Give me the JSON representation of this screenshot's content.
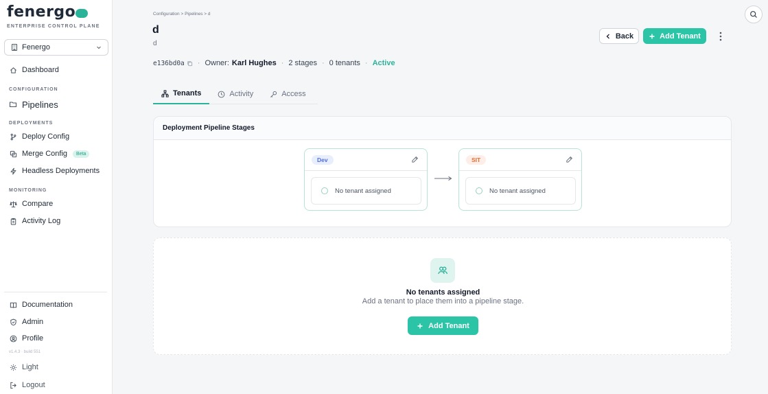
{
  "brand": {
    "logo_text": "fenergo",
    "subtitle": "ENTERPRISE CONTROL PLANE",
    "accent": "#2bc4a6"
  },
  "sidebar": {
    "org_select": "Fenergo",
    "dashboard": "Dashboard",
    "section_configuration": "CONFIGURATION",
    "pipelines": "Pipelines",
    "section_deployments": "DEPLOYMENTS",
    "deploy_config": "Deploy Config",
    "merge_config": "Merge Config",
    "beta_badge": "Beta",
    "headless": "Headless Deployments",
    "section_monitoring": "MONITORING",
    "compare": "Compare",
    "activity_log": "Activity Log",
    "documentation": "Documentation",
    "admin": "Admin",
    "profile": "Profile",
    "version": "v1.4.3 · build 551",
    "theme": "Light",
    "logout": "Logout"
  },
  "header": {
    "breadcrumb": "Configuration  >  Pipelines  >  d",
    "title": "d",
    "subtitle": "d",
    "pipeline_id": "e136bd0a",
    "owner_label": "Owner:",
    "owner_name": "Karl Hughes",
    "stages": "2 stages",
    "tenants": "0 tenants",
    "status": "Active",
    "back_label": "Back",
    "add_tenant_label": "Add Tenant"
  },
  "tabs": [
    {
      "label": "Tenants",
      "icon": "hierarchy-icon",
      "active": true
    },
    {
      "label": "Activity",
      "icon": "clock-icon",
      "active": false
    },
    {
      "label": "Access",
      "icon": "key-icon",
      "active": false
    }
  ],
  "stages_card": {
    "title": "Deployment Pipeline Stages",
    "stages": [
      {
        "name": "Dev",
        "slot": "No tenant assigned"
      },
      {
        "name": "SIT",
        "slot": "No tenant assigned"
      }
    ]
  },
  "empty_state": {
    "title": "No tenants assigned",
    "description": "Add a tenant to place them into a pipeline stage.",
    "button": "Add Tenant"
  }
}
